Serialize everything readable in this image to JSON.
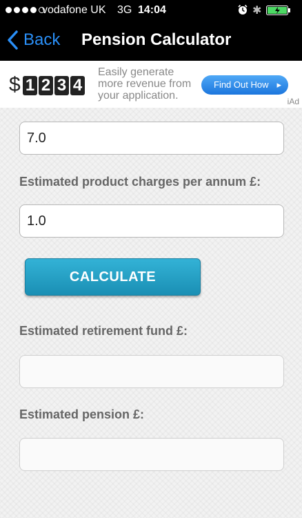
{
  "status_bar": {
    "carrier": "vodafone UK",
    "network": "3G",
    "time": "14:04"
  },
  "navbar": {
    "back_label": "Back",
    "title": "Pension Calculator"
  },
  "ad": {
    "dollar_sign": "$",
    "digits": [
      "1",
      "2",
      "3",
      "4"
    ],
    "text_line1": "Easily generate",
    "text_line2": "more revenue from",
    "text_line3": "your application.",
    "button_label": "Find Out How",
    "badge": "iAd"
  },
  "form": {
    "first_field_value": "7.0",
    "charges_label": "Estimated product charges per annum £:",
    "charges_value": "1.0",
    "calculate_label": "CALCULATE",
    "fund_label": "Estimated retirement fund £:",
    "fund_value": "",
    "pension_label": "Estimated pension £:",
    "pension_value": ""
  },
  "colors": {
    "accent_blue": "#2a8ff7",
    "button_teal": "#1a8fb4",
    "battery_green": "#4cd964"
  }
}
